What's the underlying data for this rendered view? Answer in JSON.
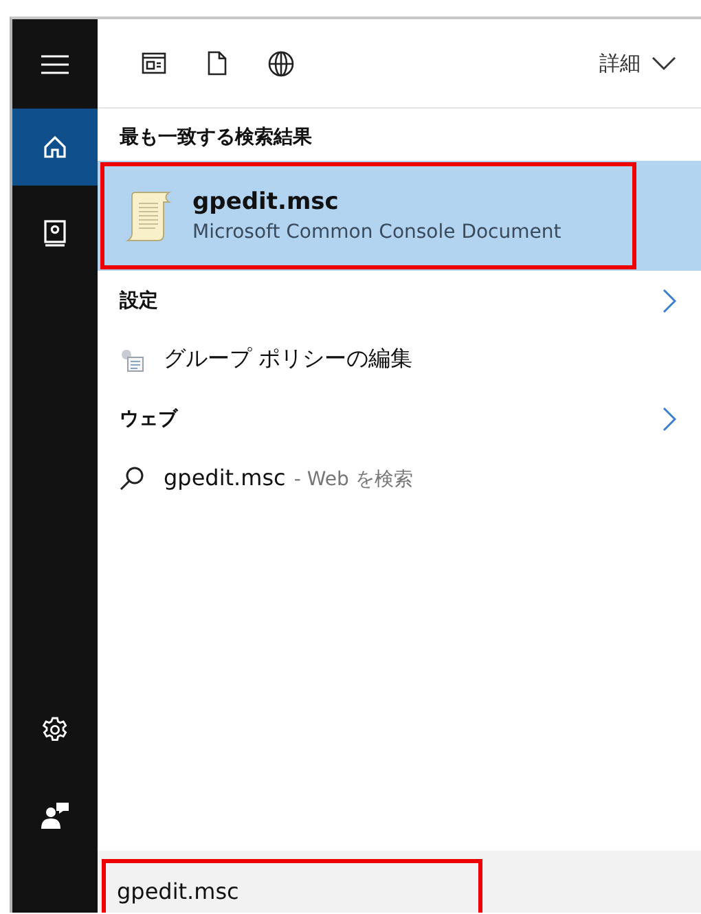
{
  "sidebar": {
    "top_items": [
      {
        "kind": "menu",
        "selected": false
      },
      {
        "kind": "home",
        "selected": true
      },
      {
        "kind": "notebook",
        "selected": false
      }
    ],
    "bottom_items": [
      {
        "kind": "settings",
        "selected": false
      },
      {
        "kind": "feedback",
        "selected": false
      }
    ]
  },
  "toolbar": {
    "filters": [
      {
        "kind": "apps"
      },
      {
        "kind": "documents"
      },
      {
        "kind": "web"
      }
    ],
    "more_label": "詳細"
  },
  "best_match": {
    "heading": "最も一致する検索結果",
    "title": "gpedit.msc",
    "subtitle": "Microsoft Common Console Document",
    "selected": true,
    "annotated": true
  },
  "sections": [
    {
      "heading": "設定",
      "items": [
        {
          "kind": "settings-app",
          "label": "グループ ポリシーの編集"
        }
      ]
    },
    {
      "heading": "ウェブ",
      "items": [
        {
          "kind": "web-search",
          "label": "gpedit.msc",
          "suffix": "- Web を検索"
        }
      ]
    }
  ],
  "search_box": {
    "value": "gpedit.msc",
    "annotated": true
  }
}
